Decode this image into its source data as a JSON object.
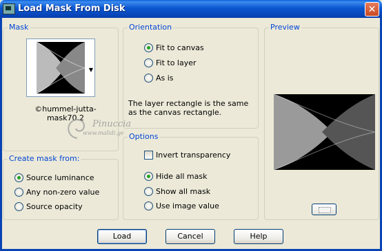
{
  "window": {
    "title": "Load Mask From Disk",
    "close_glyph": "✕"
  },
  "mask_group": {
    "title": "Mask",
    "mask_name": "©hummel-jutta-mask70.2"
  },
  "create_group": {
    "title": "Create mask from:",
    "options": [
      {
        "label": "Source luminance",
        "checked": true
      },
      {
        "label": "Any non-zero value",
        "checked": false
      },
      {
        "label": "Source opacity",
        "checked": false
      }
    ]
  },
  "orientation_group": {
    "title": "Orientation",
    "options": [
      {
        "label": "Fit to canvas",
        "checked": true
      },
      {
        "label": "Fit to layer",
        "checked": false
      },
      {
        "label": "As is",
        "checked": false
      }
    ],
    "description": "The layer rectangle is the same as the canvas rectangle."
  },
  "options_group": {
    "title": "Options",
    "invert_label": "Invert transparency",
    "invert_checked": false,
    "options": [
      {
        "label": "Hide all mask",
        "checked": true
      },
      {
        "label": "Show all mask",
        "checked": false
      },
      {
        "label": "Use image value",
        "checked": false
      }
    ]
  },
  "preview_group": {
    "title": "Preview"
  },
  "buttons": {
    "load": "Load",
    "cancel": "Cancel",
    "help": "Help"
  },
  "watermark": {
    "main": "Pinuccia",
    "sub": "www.malidi.ge"
  },
  "colors": {
    "titlebar": "#0a5fd8",
    "face": "#ece9d8",
    "group_title": "#0046d5",
    "radio_dot": "#21a121"
  }
}
